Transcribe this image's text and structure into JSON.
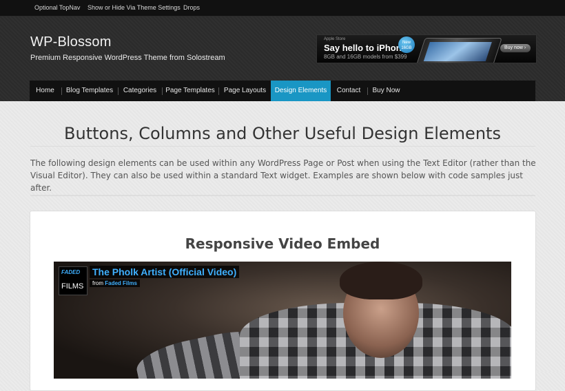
{
  "topnav": {
    "items": [
      "Optional TopNav",
      "Show or Hide Via Theme Settings",
      "Drops"
    ]
  },
  "header": {
    "site_title": "WP-Blossom",
    "site_description": "Premium Responsive WordPress Theme from Solostream"
  },
  "ad": {
    "apple_store": "Apple Store",
    "headline": "Say hello to iPhone.",
    "subtext": "8GB and 16GB models from $399",
    "badge": "New 16GB",
    "buy_label": "Buy now"
  },
  "nav": {
    "items": [
      {
        "label": "Home",
        "active": false
      },
      {
        "label": "Blog Templates",
        "active": false
      },
      {
        "label": "Categories",
        "active": false
      },
      {
        "label": "Page Templates",
        "active": false
      },
      {
        "label": "Page Layouts",
        "active": false
      },
      {
        "label": "Design Elements",
        "active": true
      },
      {
        "label": "Contact",
        "active": false
      },
      {
        "label": "Buy Now",
        "active": false
      }
    ],
    "active_color": "#1996c4"
  },
  "main": {
    "page_title": "Buttons, Columns and Other Useful Design Elements",
    "intro": "The following design elements can be used within any WordPress Page or Post when using the Text Editor (rather than the Visual Editor). They can also be used within a standard Text widget. Examples are shown below with code samples just after."
  },
  "card": {
    "title": "Responsive Video Embed",
    "video": {
      "logo_top": "FADED",
      "logo_bottom": "FILMS",
      "title": "The Pholk Artist (Official Video)",
      "from_label": "from",
      "channel": "Faded Films"
    }
  }
}
